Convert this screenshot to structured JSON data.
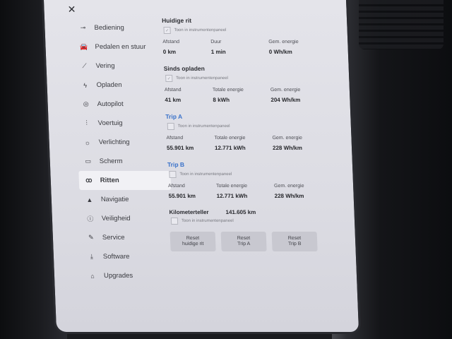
{
  "window": {
    "close_glyph": "✕"
  },
  "sidebar": {
    "items": [
      {
        "label": "Bediening",
        "icon": "toggle-icon",
        "glyph": "⊸"
      },
      {
        "label": "Pedalen en stuur",
        "icon": "car-icon",
        "glyph": "🚘"
      },
      {
        "label": "Vering",
        "icon": "suspension-icon",
        "glyph": "⟋"
      },
      {
        "label": "Opladen",
        "icon": "bolt-icon",
        "glyph": "ϟ"
      },
      {
        "label": "Autopilot",
        "icon": "steering-wheel-icon",
        "glyph": "◎"
      },
      {
        "label": "Voertuig",
        "icon": "sliders-icon",
        "glyph": "⫶"
      },
      {
        "label": "Verlichting",
        "icon": "light-icon",
        "glyph": "☼"
      },
      {
        "label": "Scherm",
        "icon": "display-icon",
        "glyph": "▭"
      },
      {
        "label": "Ritten",
        "icon": "trips-icon",
        "glyph": "ꝏ"
      },
      {
        "label": "Navigatie",
        "icon": "navigation-icon",
        "glyph": "▲"
      },
      {
        "label": "Veiligheid",
        "icon": "safety-icon",
        "glyph": "ⓘ"
      },
      {
        "label": "Service",
        "icon": "wrench-icon",
        "glyph": "✎"
      },
      {
        "label": "Software",
        "icon": "download-icon",
        "glyph": "⤓"
      },
      {
        "label": "Upgrades",
        "icon": "bag-icon",
        "glyph": "⌂"
      }
    ],
    "active_index": 8
  },
  "current_trip": {
    "title": "Huidige rit",
    "checkbox_label": "Toon in instrumentenpaneel",
    "distance_label": "Afstand",
    "distance": "0 km",
    "duration_label": "Duur",
    "duration": "1 min",
    "avg_energy_label": "Gem. energie",
    "avg_energy": "0 Wh/km"
  },
  "since_charge": {
    "title": "Sinds opladen",
    "checkbox_label": "Toon in instrumentenpaneel",
    "distance_label": "Afstand",
    "distance": "41 km",
    "total_energy_label": "Totale energie",
    "total_energy": "8 kWh",
    "avg_energy_label": "Gem. energie",
    "avg_energy": "204 Wh/km"
  },
  "trip_a": {
    "title": "Trip A",
    "checkbox_label": "Toon in instrumentenpaneel",
    "distance_label": "Afstand",
    "distance": "55.901 km",
    "total_energy_label": "Totale energie",
    "total_energy": "12.771 kWh",
    "avg_energy_label": "Gem. energie",
    "avg_energy": "228 Wh/km"
  },
  "trip_b": {
    "title": "Trip B",
    "checkbox_label": "Toon in instrumentenpaneel",
    "distance_label": "Afstand",
    "distance": "55.901 km",
    "total_energy_label": "Totale energie",
    "total_energy": "12.771 kWh",
    "avg_energy_label": "Gem. energie",
    "avg_energy": "228 Wh/km"
  },
  "odometer": {
    "label": "Kilometerteller",
    "value": "141.605 km",
    "checkbox_label": "Toon in instrumentenpaneel"
  },
  "buttons": {
    "reset_current": "Reset\nhuidige rit",
    "reset_a": "Reset\nTrip A",
    "reset_b": "Reset\nTrip B"
  }
}
